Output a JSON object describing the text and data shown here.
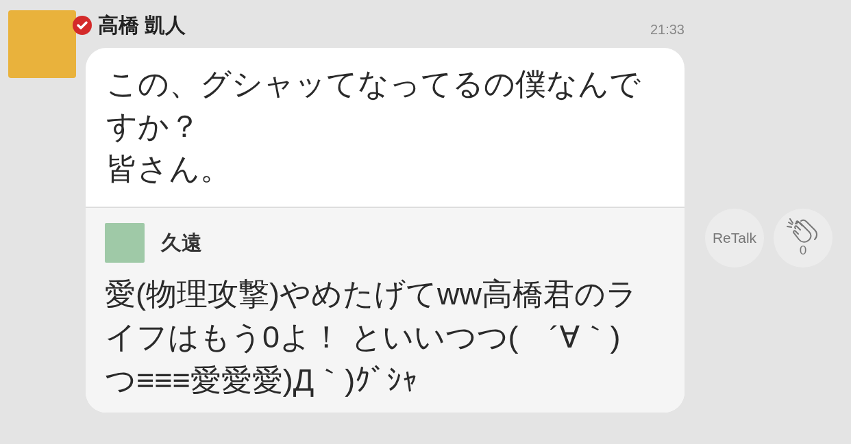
{
  "post": {
    "author": "高橋 凱人",
    "verified": true,
    "time": "21:33",
    "text_lines": [
      "この、グシャッてなってるの僕なんですか？",
      "皆さん。"
    ],
    "quote": {
      "author": "久遠",
      "text": "愛(物理攻撃)やめたげてww高橋君のライフはもう0よ！ といいつつ(　´∀｀)つ≡≡≡愛愛愛)Д｀)ｸﾞｼｬ"
    }
  },
  "actions": {
    "retalk": "ReTalk",
    "clap_count": "0"
  }
}
